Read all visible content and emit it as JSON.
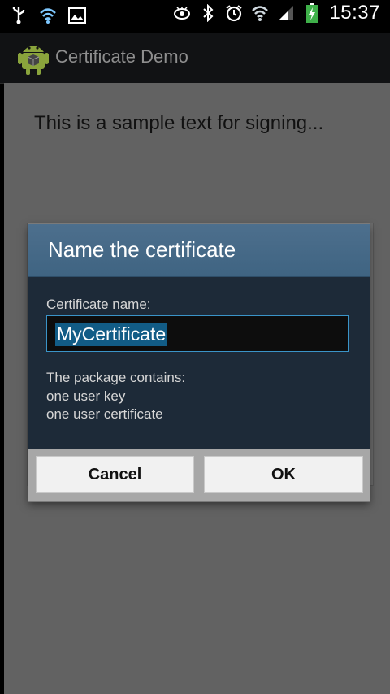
{
  "status_bar": {
    "left_icons": [
      "usb-icon",
      "wifi-icon",
      "image-icon"
    ],
    "right_icons": [
      "eye-icon",
      "bluetooth-icon",
      "alarm-icon",
      "wifi-signal-icon",
      "cell-signal-icon",
      "battery-charging-icon"
    ],
    "time": "15:37"
  },
  "action_bar": {
    "app_icon": "android-icon",
    "title": "Certificate Demo"
  },
  "content": {
    "sample_text": "This is a sample text for signing..."
  },
  "dialog": {
    "title": "Name the certificate",
    "field_label": "Certificate name:",
    "field_value": "MyCertificate",
    "package_intro": "The package contains:",
    "package_items": [
      "one user key",
      "one user certificate"
    ],
    "cancel_label": "Cancel",
    "ok_label": "OK"
  },
  "colors": {
    "dialog_header": "#456a88",
    "dialog_body": "#1d2a38",
    "input_border": "#3a94c8",
    "selection": "#125c86"
  }
}
